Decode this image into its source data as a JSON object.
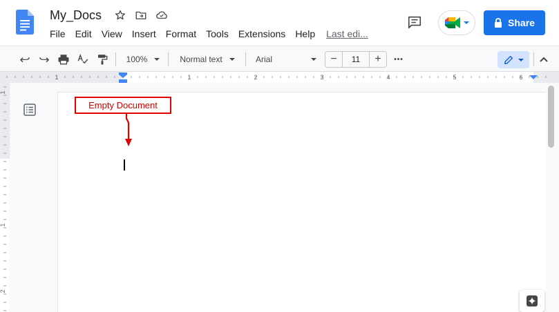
{
  "app": {
    "doc_title": "My_Docs",
    "menus": [
      "File",
      "Edit",
      "View",
      "Insert",
      "Format",
      "Tools",
      "Extensions",
      "Help"
    ],
    "last_edit": "Last edi...",
    "share_label": "Share"
  },
  "toolbar": {
    "zoom": "100%",
    "style": "Normal text",
    "font": "Arial",
    "font_size": "11",
    "minus": "−",
    "plus": "+",
    "more": "•••"
  },
  "ruler": {
    "top_numbers": [
      "1",
      "1",
      "2",
      "3",
      "4",
      "5",
      "6"
    ],
    "side_numbers": [
      "1",
      "1",
      "2"
    ]
  },
  "annotation": {
    "label": "Empty Document"
  },
  "colors": {
    "accent": "#1a73e8",
    "annotation": "#e00000",
    "docs_blue": "#4285f4"
  }
}
